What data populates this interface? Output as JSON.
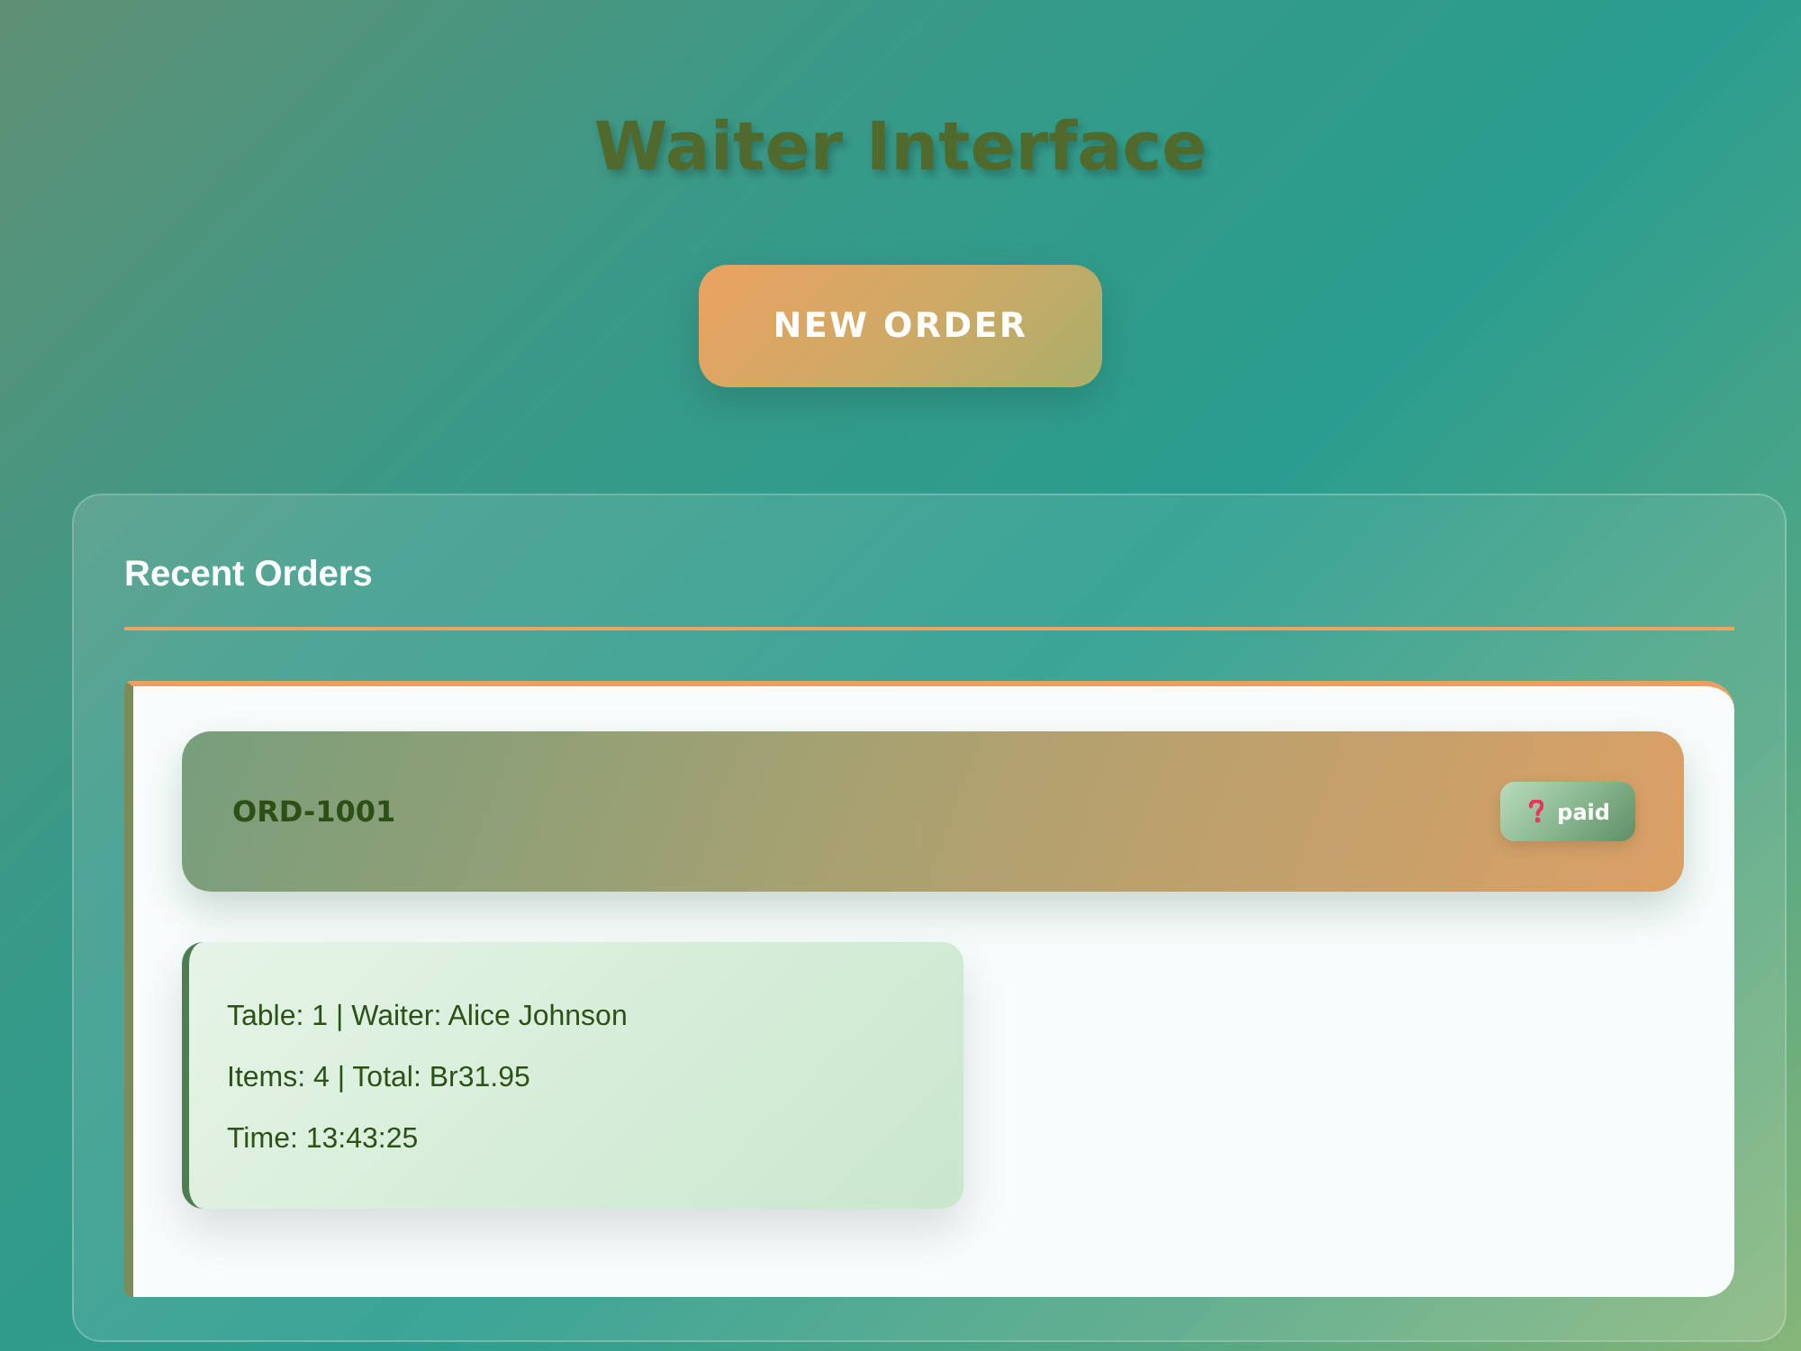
{
  "header": {
    "title": "Waiter Interface"
  },
  "new_order_button": {
    "label": "NEW ORDER"
  },
  "recent_orders": {
    "title": "Recent Orders",
    "orders": [
      {
        "id": "ORD-1001",
        "status": "paid",
        "details": [
          "Table: 1 | Waiter: Alice Johnson",
          "Items: 4 | Total: Br31.95",
          "Time: 13:43:25"
        ]
      }
    ]
  }
}
